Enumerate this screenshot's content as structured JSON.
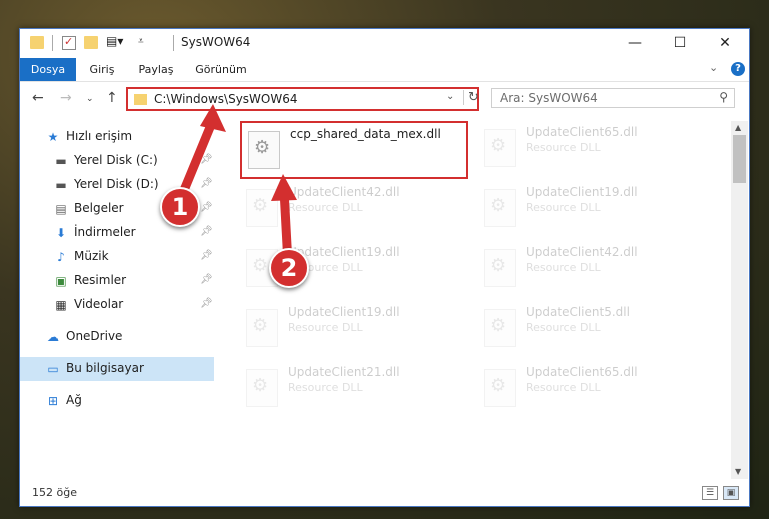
{
  "window": {
    "title": "SysWOW64",
    "controls": {
      "minimize": "—",
      "maximize": "☐",
      "close": "✕"
    }
  },
  "ribbon": {
    "tabs": [
      "Dosya",
      "Giriş",
      "Paylaş",
      "Görünüm"
    ],
    "help": "?"
  },
  "address": {
    "path": "C:\\Windows\\SysWOW64",
    "search_placeholder": "Ara: SysWOW64"
  },
  "sidebar": {
    "items": [
      {
        "label": "Hızlı erişim",
        "icon": "star-icon",
        "pinned": false
      },
      {
        "label": "Yerel Disk (C:)",
        "icon": "drive-icon",
        "pinned": true
      },
      {
        "label": "Yerel Disk (D:)",
        "icon": "drive-icon",
        "pinned": true
      },
      {
        "label": "Belgeler",
        "icon": "document-icon",
        "pinned": true
      },
      {
        "label": "İndirmeler",
        "icon": "download-icon",
        "pinned": true
      },
      {
        "label": "Müzik",
        "icon": "music-icon",
        "pinned": true
      },
      {
        "label": "Resimler",
        "icon": "picture-icon",
        "pinned": true
      },
      {
        "label": "Videolar",
        "icon": "video-icon",
        "pinned": true
      },
      {
        "label": "OneDrive",
        "icon": "cloud-icon",
        "pinned": false
      },
      {
        "label": "Bu bilgisayar",
        "icon": "computer-icon",
        "pinned": false,
        "selected": true
      },
      {
        "label": "Ağ",
        "icon": "network-icon",
        "pinned": false
      }
    ]
  },
  "files": [
    {
      "name": "ccp_shared_data_mex.dll",
      "type": ""
    },
    {
      "name": "UpdateClient65.dll",
      "type": "Resource DLL"
    },
    {
      "name": "UpdateClient42.dll",
      "type": "Resource DLL"
    },
    {
      "name": "UpdateClient19.dll",
      "type": "Resource DLL"
    },
    {
      "name": "UpdateClient19.dll",
      "type": "Resource DLL"
    },
    {
      "name": "UpdateClient42.dll",
      "type": "Resource DLL"
    },
    {
      "name": "UpdateClient19.dll",
      "type": "Resource DLL"
    },
    {
      "name": "UpdateClient5.dll",
      "type": "Resource DLL"
    },
    {
      "name": "UpdateClient21.dll",
      "type": "Resource DLL"
    },
    {
      "name": "UpdateClient65.dll",
      "type": "Resource DLL"
    }
  ],
  "status": {
    "item_count": "152 öğe"
  },
  "callouts": [
    "1",
    "2"
  ],
  "colors": {
    "accent": "#1a6fc6",
    "highlight": "#d32f2f",
    "selected_bg": "#cce4f7"
  }
}
